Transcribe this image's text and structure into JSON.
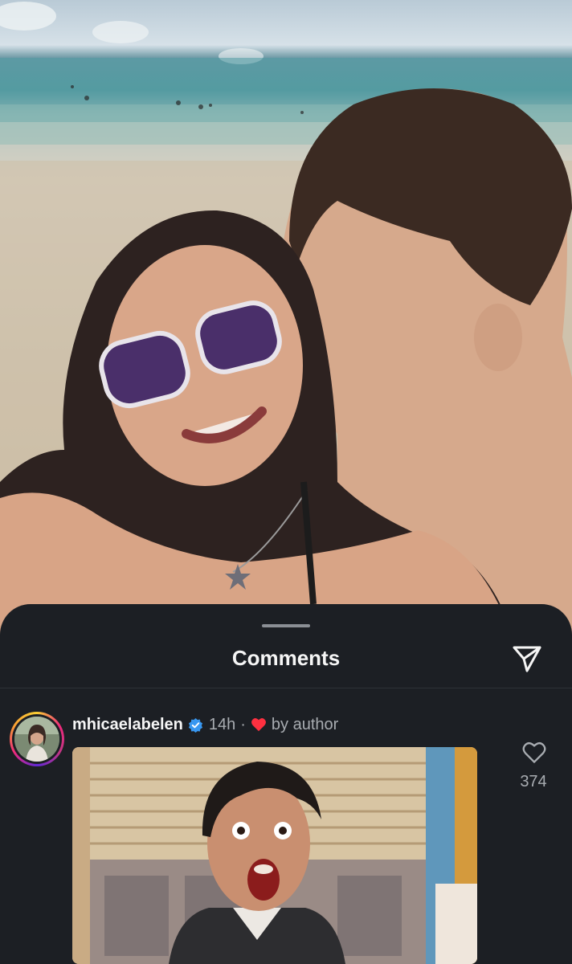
{
  "post": {
    "image_description_icon": "beach-selfie-photo"
  },
  "comments_sheet": {
    "title": "Comments",
    "share_icon": "paper-plane-icon"
  },
  "comments": [
    {
      "username": "mhicaelabelen",
      "verified": true,
      "time": "14h",
      "separator": "·",
      "liked_by_author_label": "by author",
      "like_count": "374",
      "media": "reaction-gif"
    }
  ],
  "colors": {
    "sheet_background": "#1c1f24",
    "verified_badge": "#3897f0",
    "author_heart": "#ff3040"
  }
}
